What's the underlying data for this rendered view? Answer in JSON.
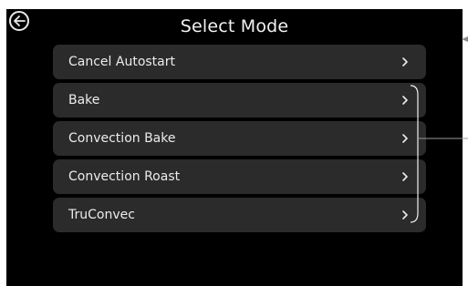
{
  "header": {
    "title": "Select Mode",
    "back_icon": "arrow-left-circle-icon"
  },
  "menu": {
    "items": [
      {
        "label": "Cancel Autostart",
        "icon": "chevron-right-icon"
      },
      {
        "label": "Bake",
        "icon": "chevron-right-icon"
      },
      {
        "label": "Convection Bake",
        "icon": "chevron-right-icon"
      },
      {
        "label": "Convection Roast",
        "icon": "chevron-right-icon"
      },
      {
        "label": "TruConvec",
        "icon": "chevron-right-icon"
      }
    ]
  },
  "colors": {
    "screen_background": "#000000",
    "item_background": "#2b2b2b",
    "text": "#ececec",
    "annotation_line": "#9a9a9a"
  }
}
